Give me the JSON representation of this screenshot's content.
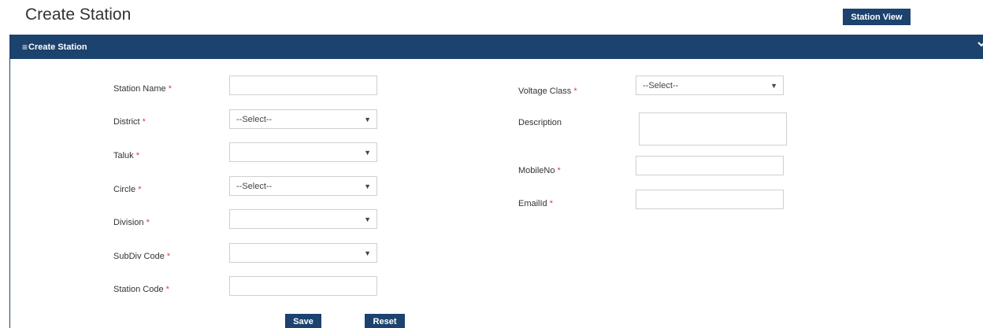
{
  "page": {
    "title": "Create Station"
  },
  "toolbar": {
    "station_view_label": "Station View"
  },
  "panel": {
    "title": "Create Station",
    "menu_icon": "hamburger-icon",
    "collapse_icon": "chevron-down-icon"
  },
  "required_marker": "*",
  "form": {
    "station_name": {
      "label": "Station Name",
      "value": ""
    },
    "district": {
      "label": "District",
      "selected": "--Select--"
    },
    "taluk": {
      "label": "Taluk",
      "selected": ""
    },
    "circle": {
      "label": "Circle",
      "selected": "--Select--"
    },
    "division": {
      "label": "Division",
      "selected": ""
    },
    "subdiv_code": {
      "label": "SubDiv Code",
      "selected": ""
    },
    "station_code": {
      "label": "Station Code",
      "value": ""
    },
    "voltage_class": {
      "label": "Voltage Class",
      "selected": "--Select--"
    },
    "description": {
      "label": "Description",
      "value": ""
    },
    "mobile_no": {
      "label": "MobileNo",
      "value": ""
    },
    "email_id": {
      "label": "EmailId",
      "value": ""
    }
  },
  "actions": {
    "save_label": "Save",
    "reset_label": "Reset"
  },
  "colors": {
    "primary": "#1c426e",
    "required": "#e23b3b"
  }
}
